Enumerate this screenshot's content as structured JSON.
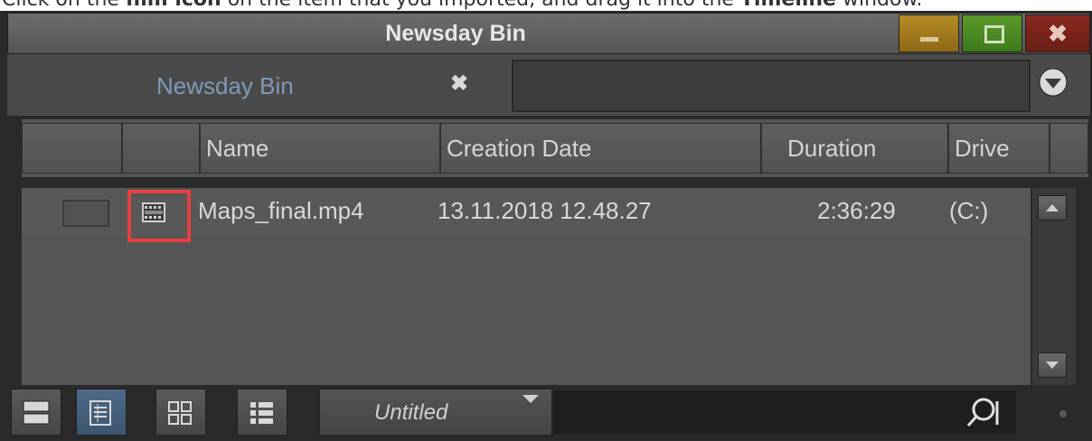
{
  "caption": {
    "prefix": "Click on the ",
    "bold1": "film icon",
    "middle": " on the item that you imported, and drag it into the ",
    "bold2": "Timeline",
    "suffix": " window."
  },
  "window": {
    "title": "Newsday Bin",
    "buttons": {
      "minimize": "minimize",
      "maximize": "maximize",
      "close": "✖"
    }
  },
  "tab": {
    "label": "Newsday Bin",
    "close": "✖"
  },
  "columns": [
    "",
    "",
    "Name",
    "Creation Date",
    "Duration",
    "Drive"
  ],
  "rows": [
    {
      "icon": "film-icon",
      "name": "Maps_final.mp4",
      "creation_date": "13.11.2018 12.48.27",
      "duration": "2:36:29",
      "drive": "(C:)"
    }
  ],
  "toolbar": {
    "view_name": "Untitled",
    "views": [
      "frame-view-icon",
      "text-view-icon",
      "grid-view-icon",
      "list-view-icon"
    ]
  },
  "colors": {
    "highlight": "#e84040",
    "minimize": "#b58a25",
    "maximize": "#5a9a2a",
    "close": "#8a2a20",
    "tab_label": "#7f9ab8"
  }
}
